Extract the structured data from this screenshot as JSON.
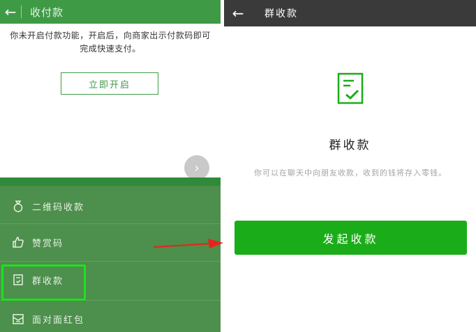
{
  "left_screen": {
    "header": {
      "title": "收付款"
    },
    "prompt": "你未开启付款功能，开启后，向商家出示付款码即可完成快速支付。",
    "open_button": "立即开启",
    "menu": {
      "items": [
        {
          "label": "二维码收款",
          "icon": "money-bag-icon"
        },
        {
          "label": "赞赏码",
          "icon": "thumbs-up-icon"
        },
        {
          "label": "群收款",
          "icon": "document-check-icon"
        },
        {
          "label": "面对面红包",
          "icon": "red-packet-icon"
        }
      ]
    }
  },
  "right_screen": {
    "header": {
      "title": "群收款"
    },
    "title": "群收款",
    "description": "你可以在聊天中向朋友收款，收到的钱将存入零钱。",
    "action_button": "发起收款"
  },
  "colors": {
    "left_header": "#3f9a45",
    "menu_background": "#4d8f4c",
    "highlight_box": "#1fe01f",
    "arrow": "#e8231c",
    "right_header": "#3a3a3a",
    "primary_button": "#1aad19"
  }
}
